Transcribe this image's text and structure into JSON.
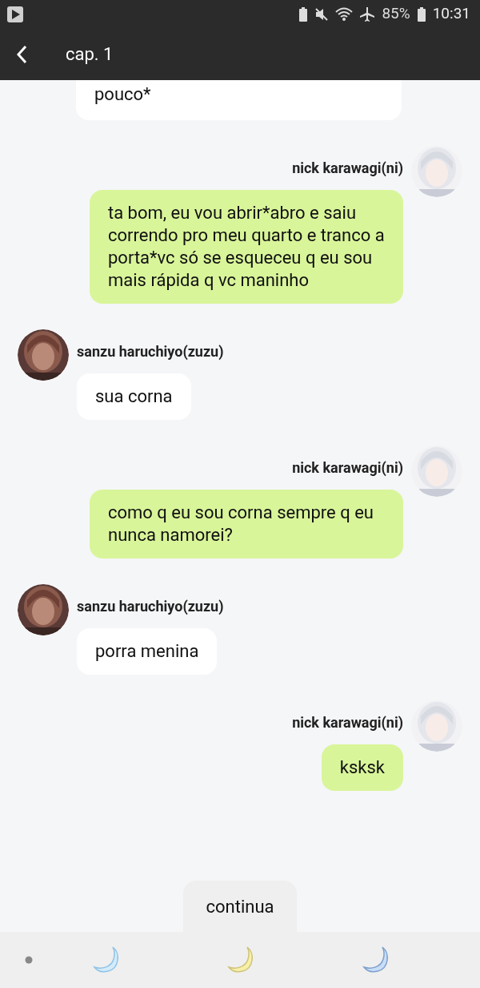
{
  "status_bar": {
    "battery": "85%",
    "time": "10:31"
  },
  "header": {
    "title": "cap. 1"
  },
  "messages": [
    {
      "kind": "cut",
      "outgoing": false,
      "text": "pouco*"
    },
    {
      "kind": "full",
      "outgoing": true,
      "sender": "nick karawagi(ni)",
      "text": "ta bom, eu vou abrir*abro e saiu correndo pro meu quarto e tranco a porta*vc só se esqueceu q eu sou mais rápida q vc maninho"
    },
    {
      "kind": "full",
      "outgoing": false,
      "sender": "sanzu haruchiyo(zuzu)",
      "text": "sua corna"
    },
    {
      "kind": "full",
      "outgoing": true,
      "sender": "nick karawagi(ni)",
      "text": "como q eu sou corna sempre q eu nunca namorei?"
    },
    {
      "kind": "full",
      "outgoing": false,
      "sender": "sanzu haruchiyo(zuzu)",
      "text": "porra menina"
    },
    {
      "kind": "full",
      "outgoing": true,
      "sender": "nick karawagi(ni)",
      "text": "ksksk"
    }
  ],
  "continue_button": {
    "label": "continua"
  }
}
